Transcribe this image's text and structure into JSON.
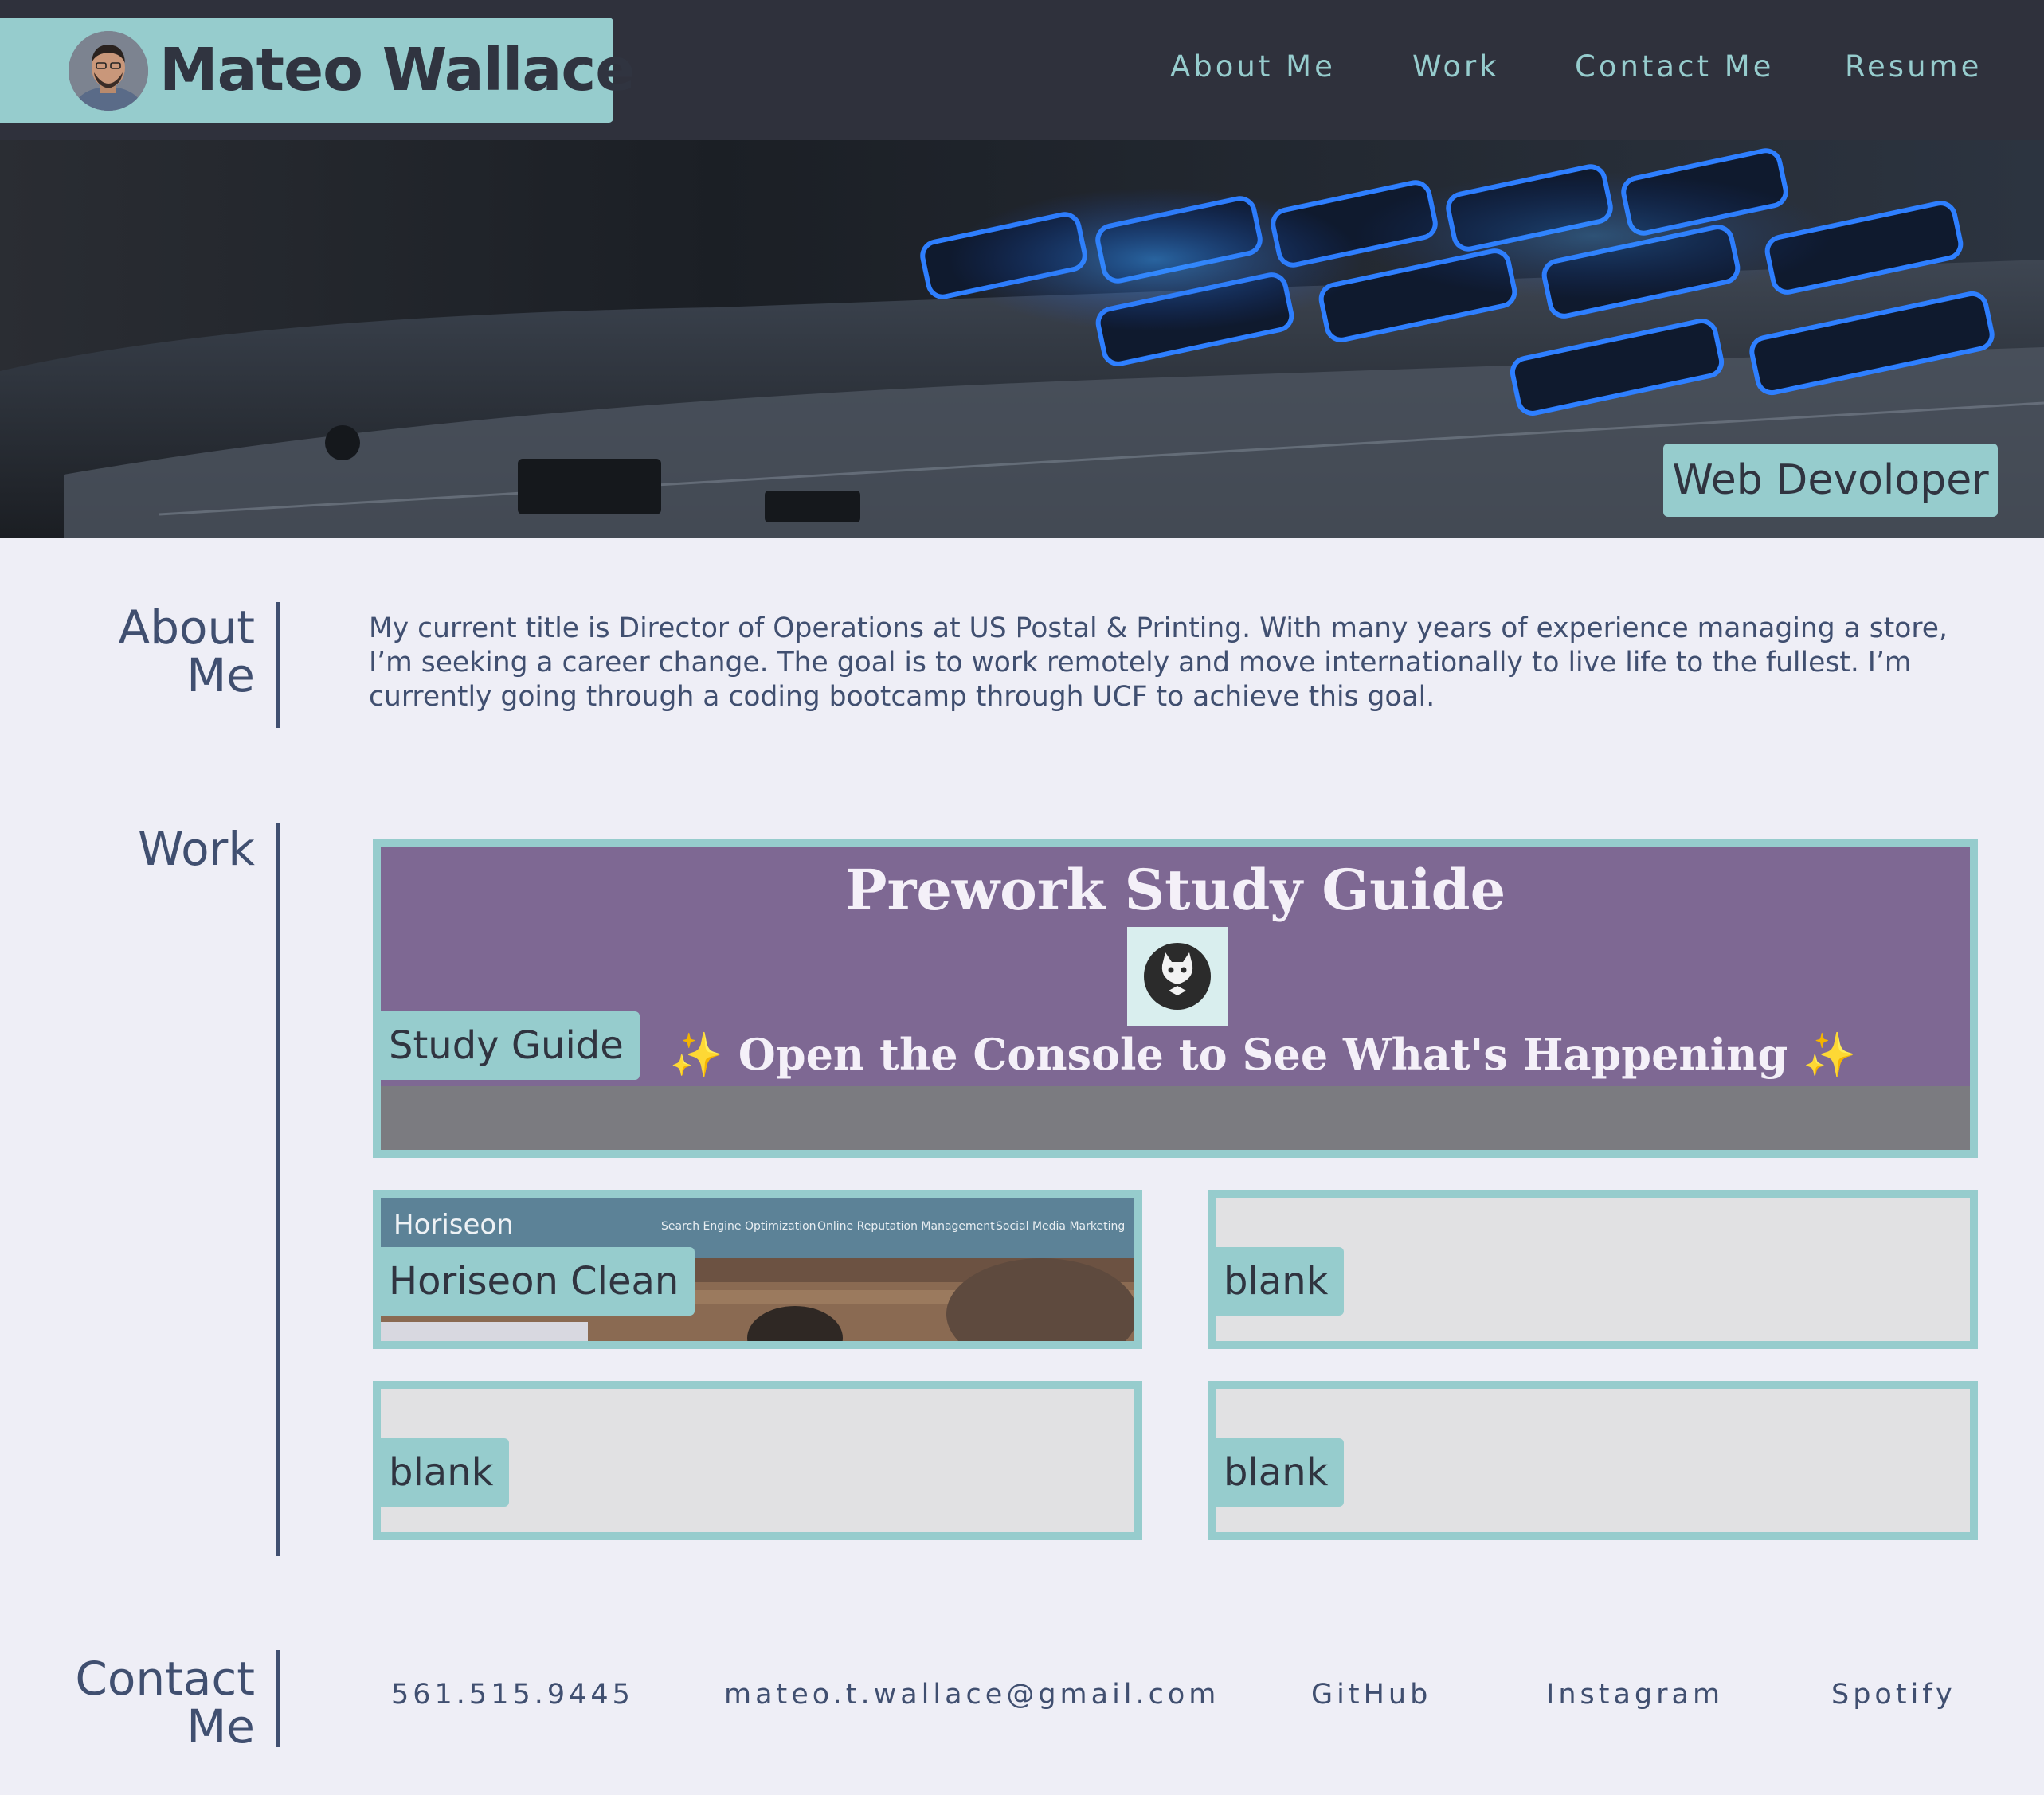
{
  "header": {
    "name": "Mateo Wallace",
    "nav": [
      "About Me",
      "Work",
      "Contact Me",
      "Resume"
    ]
  },
  "hero": {
    "badge": "Web Devoloper"
  },
  "about": {
    "title_line1": "About",
    "title_line2": "Me",
    "text": "My current title is Director of Operations at US Postal & Printing. With many years of experience managing a store, I’m seeking a career change. The goal is to work remotely and move internationally to live life to the fullest. I’m currently going through a coding bootcamp through UCF to achieve this goal."
  },
  "work": {
    "title": "Work",
    "featured": {
      "label": "Study Guide",
      "thumb_title": "Prework Study Guide",
      "thumb_subtitle": "Open the Console to See What's Happening",
      "spark": "✨"
    },
    "projects": [
      {
        "label": "Horiseon Clean",
        "thumb_logo": "Horiseon",
        "thumb_links": [
          "Search Engine Optimization",
          "Online Reputation Management",
          "Social Media Marketing"
        ]
      },
      {
        "label": "blank"
      },
      {
        "label": "blank"
      },
      {
        "label": "blank"
      }
    ]
  },
  "contact": {
    "title_line1": "Contact",
    "title_line2": "Me",
    "links": [
      "561.515.9445",
      "mateo.t.wallace@gmail.com",
      "GitHub",
      "Instagram",
      "Spotify"
    ]
  },
  "colors": {
    "accent": "#96cccd",
    "header_bg": "#2f313c",
    "page_bg": "#eeeef6",
    "text": "#404f70"
  }
}
